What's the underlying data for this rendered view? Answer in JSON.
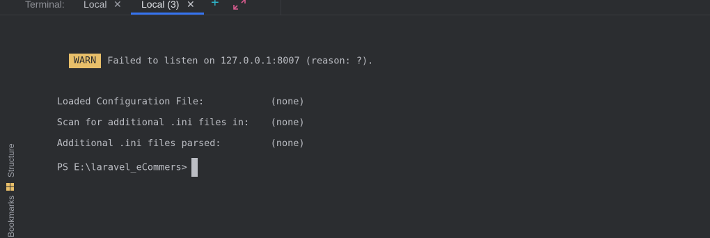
{
  "tabbar": {
    "title": "Terminal:",
    "tabs": [
      {
        "label": "Local",
        "close": "✕",
        "active": false
      },
      {
        "label": "Local (3)",
        "close": "✕",
        "active": true
      }
    ],
    "add_label": "+",
    "accent_color": "#3574f0"
  },
  "sidebar": {
    "tools": [
      {
        "label": "Structure",
        "icon": "structure-icon"
      },
      {
        "label": "Bookmarks",
        "icon": null
      }
    ]
  },
  "terminal": {
    "warn_badge": "WARN",
    "warn_message": "Failed to listen on 127.0.0.1:8007 (reason: ?).",
    "config_rows": [
      {
        "key": "Loaded Configuration File:",
        "value": "(none)"
      },
      {
        "key": "Scan for additional .ini files in:",
        "value": "(none)"
      },
      {
        "key": "Additional .ini files parsed:",
        "value": "(none)"
      }
    ],
    "prompt": "PS E:\\laravel_eCommers>"
  }
}
